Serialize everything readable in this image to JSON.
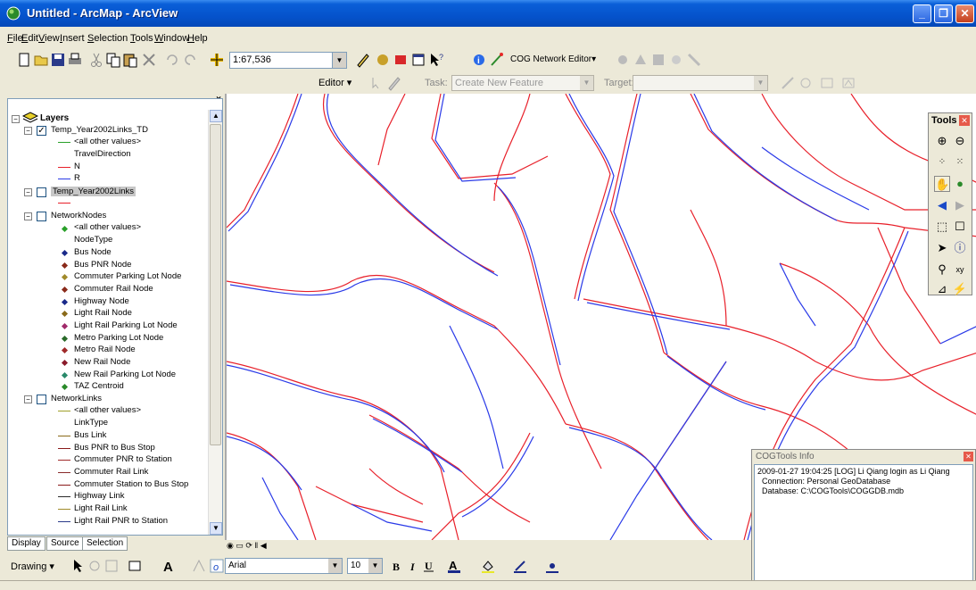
{
  "window": {
    "title": "Untitled - ArcMap - ArcView",
    "min": "_",
    "max": "❐",
    "close": "✕"
  },
  "menu": [
    "File",
    "Edit",
    "View",
    "Insert",
    "Selection",
    "Tools",
    "Window",
    "Help"
  ],
  "toolbar": {
    "scale": "1:67,536",
    "cog_editor": "COG Network Editor▾"
  },
  "editor": {
    "label": "Editor ▾",
    "task_label": "Task:",
    "task_value": "Create New Feature",
    "target_label": "Target:",
    "target_value": ""
  },
  "toc": {
    "root": "Layers",
    "layer1": {
      "name": "Temp_Year2002Links_TD",
      "items": [
        "<all other values>",
        "TravelDirection",
        "N",
        "R"
      ]
    },
    "layer2": {
      "name": "Temp_Year2002Links"
    },
    "layer3": {
      "name": "NetworkNodes",
      "all_other": "<all other values>",
      "field": "NodeType",
      "items": [
        "Bus Node",
        "Bus PNR Node",
        "Commuter Parking Lot Node",
        "Commuter Rail Node",
        "Highway Node",
        "Light Rail Node",
        "Light Rail Parking Lot Node",
        "Metro Parking Lot Node",
        "Metro Rail Node",
        "New Rail Node",
        "New Rail Parking Lot Node",
        "TAZ Centroid"
      ]
    },
    "layer4": {
      "name": "NetworkLinks",
      "all_other": "<all other values>",
      "field": "LinkType",
      "items": [
        "Bus Link",
        "Bus PNR to Bus Stop",
        "Commuter PNR to Station",
        "Commuter Rail Link",
        "Commuter Station to Bus Stop",
        "Highway Link",
        "Light Rail Link",
        "Light Rail PNR to Station"
      ]
    }
  },
  "tabs": [
    "Display",
    "Source",
    "Selection"
  ],
  "tools_panel": {
    "title": "Tools"
  },
  "info": {
    "title": "COGTools Info",
    "lines": [
      "2009-01-27 19:04:25 [LOG] Li Qiang login as Li Qiang",
      "  Connection: Personal GeoDatabase",
      "  Database: C:\\COGTools\\COGGDB.mdb"
    ]
  },
  "drawing": {
    "label": "Drawing ▾",
    "font": "Arial",
    "size": "10"
  },
  "colors": {
    "red_line": "#e8202a",
    "blue_line": "#2a3ae8",
    "green_line": "#2aa02a"
  }
}
